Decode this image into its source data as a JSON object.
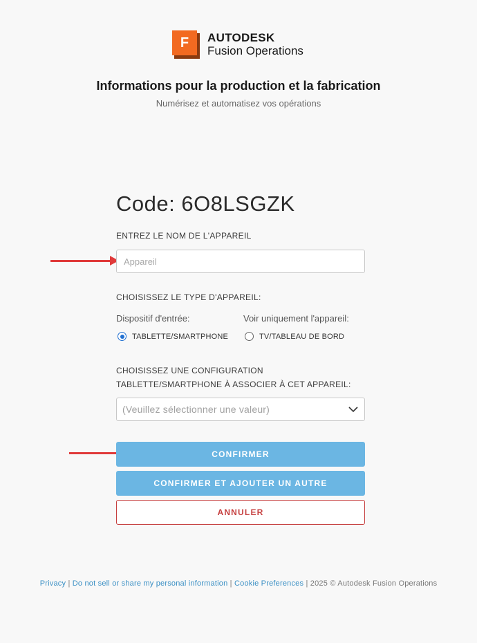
{
  "brand": {
    "company": "AUTODESK",
    "product": "Fusion Operations",
    "logo_letter": "F",
    "logo_color": "#f26a21"
  },
  "header": {
    "title": "Informations pour la production et la fabrication",
    "subtitle": "Numérisez et automatisez vos opérations"
  },
  "form": {
    "code": "Code: 6O8LSGZK",
    "device_name_label": "ENTREZ LE NOM DE L'APPAREIL",
    "device_name_placeholder": "Appareil",
    "device_name_value": "",
    "device_type_label": "CHOISISSEZ LE TYPE D'APPAREIL:",
    "input_device_label": "Dispositif d'entrée:",
    "view_only_label": "Voir uniquement l'appareil:",
    "option_tablet": "TABLETTE/SMARTPHONE",
    "option_tv": "TV/TABLEAU DE BORD",
    "selected_option": "TABLETTE/SMARTPHONE",
    "config_label": "CHOISISSEZ UNE CONFIGURATION TABLETTE/SMARTPHONE À ASSOCIER À CET APPAREIL:",
    "config_placeholder": "(Veuillez sélectionner une valeur)"
  },
  "buttons": {
    "confirm": "CONFIRMER",
    "confirm_add": "CONFIRMER ET AJOUTER UN AUTRE",
    "cancel": "ANNULER"
  },
  "footer": {
    "privacy": "Privacy",
    "do_not_sell": "Do not sell or share my personal information",
    "cookie_prefs": "Cookie Preferences",
    "separator": "|",
    "copyright": "2025 © Autodesk Fusion Operations"
  },
  "colors": {
    "primary_button": "#6bb6e3",
    "cancel": "#c64040",
    "annotation_arrow": "#e03a3a",
    "link": "#3a8fc4"
  }
}
